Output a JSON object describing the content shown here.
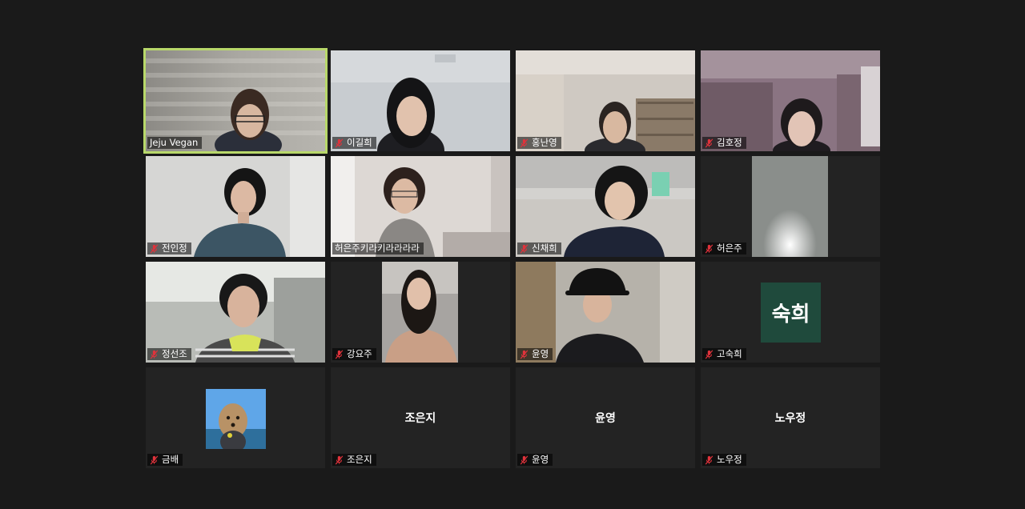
{
  "participants": [
    {
      "name": "Jeju Vegan",
      "muted": false,
      "active": true
    },
    {
      "name": "이길희",
      "muted": true
    },
    {
      "name": "홍난영",
      "muted": true
    },
    {
      "name": "김호정",
      "muted": true
    },
    {
      "name": "전인정",
      "muted": true
    },
    {
      "name": "허은주키라키라라라라",
      "muted": true
    },
    {
      "name": "신채희",
      "muted": true
    },
    {
      "name": "허은주",
      "muted": true
    },
    {
      "name": "정선조",
      "muted": true
    },
    {
      "name": "강요주",
      "muted": true
    },
    {
      "name": "윤영",
      "muted": true
    },
    {
      "name": "고숙희",
      "muted": true,
      "avatar_text": "숙희"
    },
    {
      "name": "금배",
      "muted": true
    },
    {
      "name": "조은지",
      "muted": true,
      "center_text": "조은지"
    },
    {
      "name": "윤영",
      "muted": true,
      "center_text": "윤영"
    },
    {
      "name": "노우정",
      "muted": true,
      "center_text": "노우정"
    }
  ],
  "colors": {
    "background": "#1a1a1a",
    "tile": "#232323",
    "active_border": "#b8d86a",
    "muted_icon": "#e0323b",
    "avatar_bg": "#1f4a3c"
  },
  "icons": {
    "muted": "microphone-muted-icon"
  }
}
